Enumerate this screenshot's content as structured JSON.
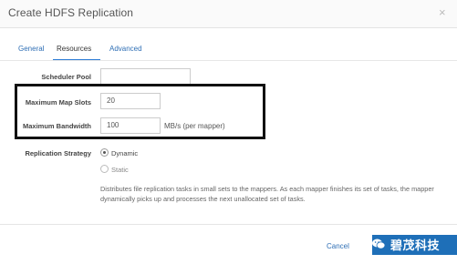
{
  "dialog": {
    "title": "Create HDFS Replication",
    "close_glyph": "×"
  },
  "tabs": [
    {
      "label": "General",
      "active": false
    },
    {
      "label": "Resources",
      "active": true
    },
    {
      "label": "Advanced",
      "active": false
    }
  ],
  "form": {
    "scheduler_pool": {
      "label": "Scheduler Pool",
      "value": ""
    },
    "max_map_slots": {
      "label": "Maximum Map Slots",
      "value": "20"
    },
    "max_bandwidth": {
      "label": "Maximum Bandwidth",
      "value": "100",
      "unit": "MB/s (per mapper)"
    },
    "replication_strategy": {
      "label": "Replication Strategy",
      "options": [
        {
          "label": "Dynamic",
          "selected": true
        },
        {
          "label": "Static",
          "selected": false
        }
      ],
      "description": "Distributes file replication tasks in small sets to the mappers. As each mapper finishes its set of tasks, the mapper dynamically picks up and processes the next unallocated set of tasks."
    }
  },
  "footer": {
    "cancel_label": "Cancel"
  },
  "watermark": {
    "text": "碧茂科技",
    "icon": "wechat-icon"
  },
  "colors": {
    "link": "#2f6fb5",
    "tab_underline": "#2b7bd6",
    "primary_button": "#1e6fb8",
    "highlight_border": "#111111"
  }
}
